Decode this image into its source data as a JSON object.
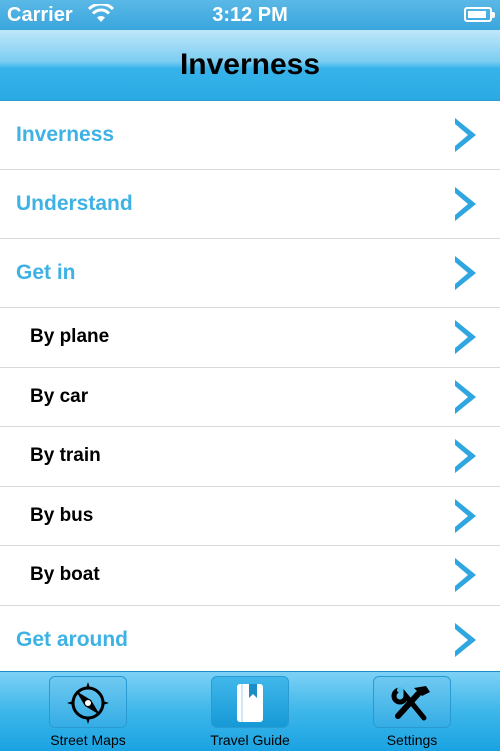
{
  "status_bar": {
    "carrier": "Carrier",
    "time": "3:12 PM",
    "battery_level": 0.9
  },
  "nav_bar": {
    "title": "Inverness"
  },
  "list": {
    "items": [
      {
        "label": "Inverness",
        "kind": "section"
      },
      {
        "label": "Understand",
        "kind": "section"
      },
      {
        "label": "Get in",
        "kind": "section"
      },
      {
        "label": "By plane",
        "kind": "sub"
      },
      {
        "label": "By car",
        "kind": "sub"
      },
      {
        "label": "By train",
        "kind": "sub"
      },
      {
        "label": "By bus",
        "kind": "sub"
      },
      {
        "label": "By boat",
        "kind": "sub"
      },
      {
        "label": "Get around",
        "kind": "section"
      }
    ]
  },
  "tab_bar": {
    "tabs": [
      {
        "label": "Street Maps",
        "icon": "compass-icon",
        "active": false
      },
      {
        "label": "Travel Guide",
        "icon": "book-icon",
        "active": true
      },
      {
        "label": "Settings",
        "icon": "tools-icon",
        "active": false
      }
    ]
  },
  "colors": {
    "accent": "#3fb2e4",
    "chevron": "#2fa6e0",
    "nav_bar": "#36b3ea"
  }
}
